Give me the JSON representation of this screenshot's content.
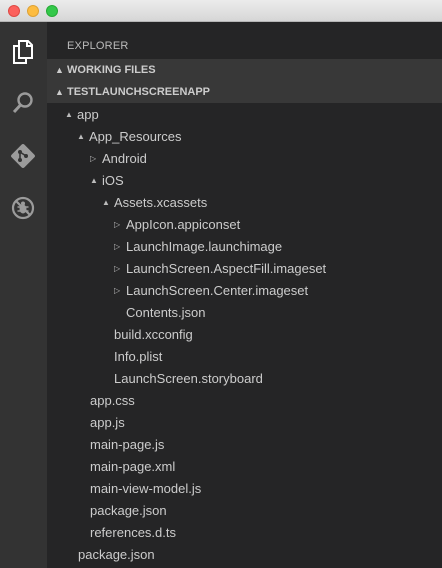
{
  "explorer": {
    "title": "EXPLORER",
    "working_files": {
      "label": "WORKING FILES",
      "expanded": true
    },
    "project": {
      "label": "TESTLAUNCHSCREENAPP",
      "expanded": true
    }
  },
  "tree": [
    {
      "name": "app",
      "twisty": "▲"
    },
    {
      "name": "App_Resources",
      "twisty": "▲"
    },
    {
      "name": "Android",
      "twisty": "▷"
    },
    {
      "name": "iOS",
      "twisty": "▲"
    },
    {
      "name": "Assets.xcassets",
      "twisty": "▲"
    },
    {
      "name": "AppIcon.appiconset",
      "twisty": "▷"
    },
    {
      "name": "LaunchImage.launchimage",
      "twisty": "▷"
    },
    {
      "name": "LaunchScreen.AspectFill.imageset",
      "twisty": "▷"
    },
    {
      "name": "LaunchScreen.Center.imageset",
      "twisty": "▷"
    },
    {
      "name": "Contents.json",
      "twisty": ""
    },
    {
      "name": "build.xcconfig",
      "twisty": ""
    },
    {
      "name": "Info.plist",
      "twisty": ""
    },
    {
      "name": "LaunchScreen.storyboard",
      "twisty": ""
    },
    {
      "name": "app.css",
      "twisty": ""
    },
    {
      "name": "app.js",
      "twisty": ""
    },
    {
      "name": "main-page.js",
      "twisty": ""
    },
    {
      "name": "main-page.xml",
      "twisty": ""
    },
    {
      "name": "main-view-model.js",
      "twisty": ""
    },
    {
      "name": "package.json",
      "twisty": ""
    },
    {
      "name": "references.d.ts",
      "twisty": ""
    },
    {
      "name": "package.json",
      "twisty": ""
    }
  ],
  "activity_icons": [
    "files-icon",
    "search-icon",
    "git-icon",
    "debug-icon"
  ]
}
